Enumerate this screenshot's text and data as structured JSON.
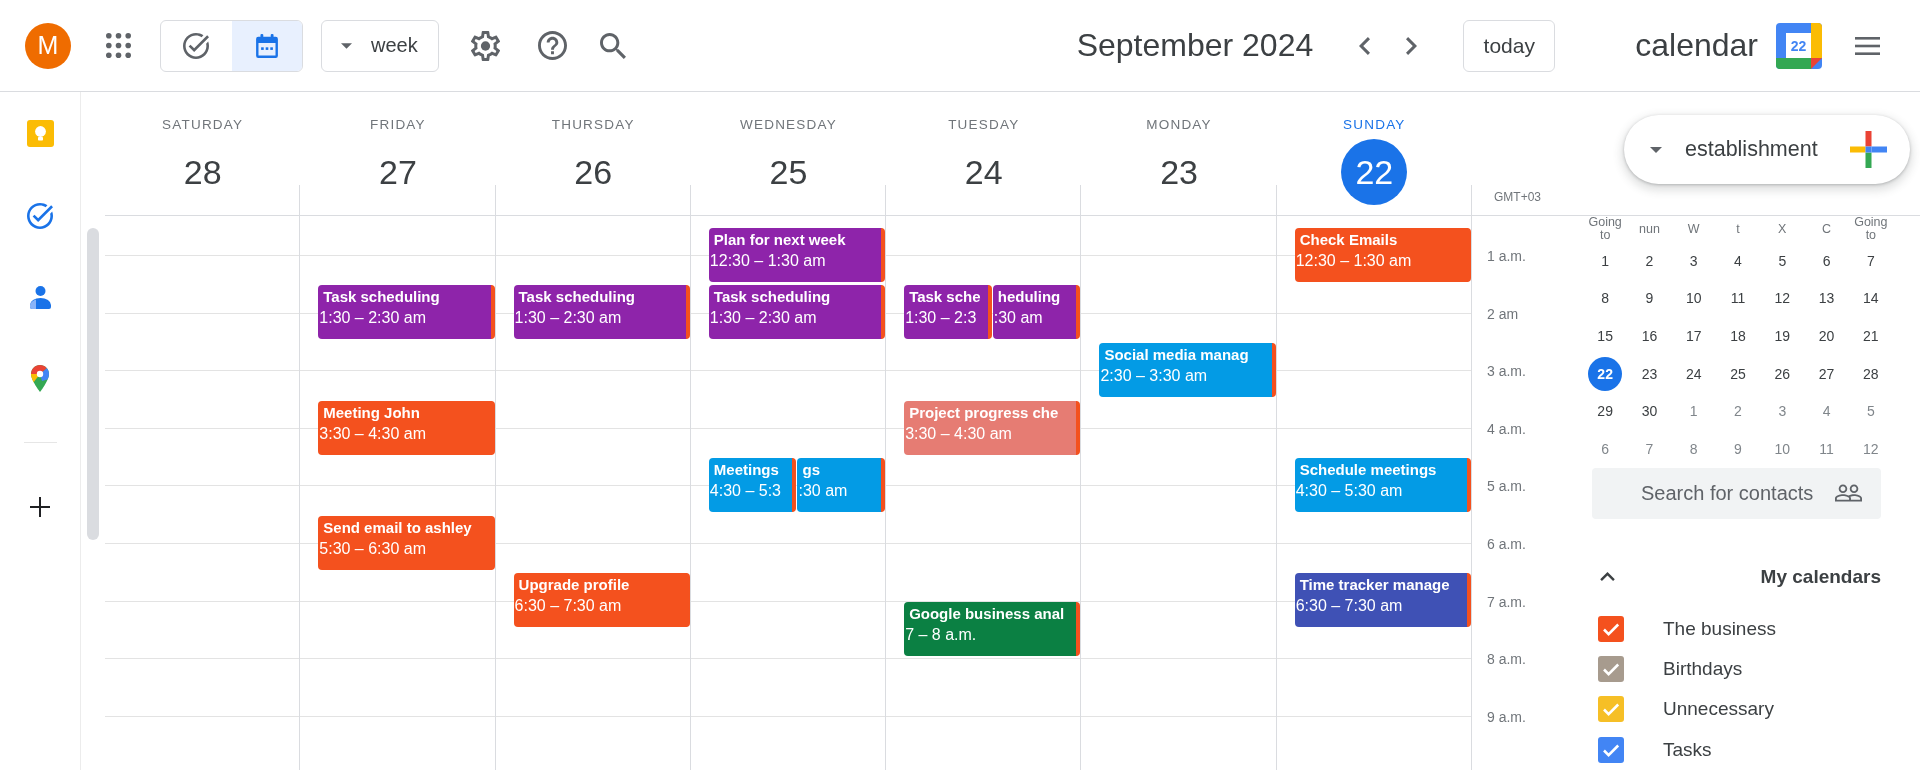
{
  "top_bar": {
    "avatar_initial": "M",
    "view_toggle": [
      {
        "kind": "tasks",
        "selected": false
      },
      {
        "kind": "calendar",
        "selected": true
      }
    ],
    "view_menu": "week",
    "month_title": "September 2024",
    "today_button": "today",
    "app_name": "calendar",
    "logo_text": "22"
  },
  "calendar": {
    "timezone": "GMT+03",
    "days": [
      {
        "name": "SATURDAY",
        "date": "28",
        "today": false
      },
      {
        "name": "FRIDAY",
        "date": "27",
        "today": false,
        "slots": [
          {
            "events": [
              {
                "title": "Task scheduling",
                "time": "1:30 – 2:30 am",
                "color": "#8e24aa"
              }
            ]
          },
          {
            "events": [
              {
                "title": "Meeting John",
                "time": "3:30 – 4:30 am",
                "color": "#f4511e"
              }
            ]
          },
          {
            "events": [
              {
                "title": "Send email to ashley",
                "time": "5:30 – 6:30 am",
                "color": "#f4511e"
              }
            ]
          }
        ]
      },
      {
        "name": "THURSDAY",
        "date": "26",
        "today": false,
        "slots": [
          {
            "events": [
              {
                "title": "Task scheduling",
                "time": "1:30 – 2:30 am",
                "color": "#8e24aa"
              }
            ]
          },
          {
            "events": [
              {
                "title": "Upgrade profile",
                "time": "6:30 – 7:30 am",
                "color": "#f4511e"
              }
            ]
          }
        ]
      },
      {
        "name": "WEDNESDAY",
        "date": "25",
        "today": false,
        "slots": [
          {
            "events": [
              {
                "title": "Plan for next week",
                "time": "12:30 – 1:30 am",
                "color": "#8e24aa"
              }
            ]
          },
          {
            "events": [
              {
                "title": "Task scheduling",
                "time": "1:30 – 2:30 am",
                "color": "#8e24aa"
              }
            ]
          },
          {
            "events": [
              {
                "title": "Meetings",
                "time": "4:30 – 5:3",
                "color": "#039be5"
              },
              {
                "title": "gs",
                "time": ":30 am",
                "color": "#039be5"
              }
            ]
          }
        ]
      },
      {
        "name": "TUESDAY",
        "date": "24",
        "today": false,
        "slots": [
          {
            "events": [
              {
                "title": "Task sche",
                "time": "1:30 – 2:3",
                "color": "#8e24aa"
              },
              {
                "title": "heduling",
                "time": ":30 am",
                "color": "#8e24aa"
              }
            ]
          },
          {
            "events": [
              {
                "title": "Project progress che",
                "time": "3:30 – 4:30 am",
                "color": "#e67c73"
              }
            ]
          },
          {
            "events": [
              {
                "title": "Google business anal",
                "time": "7 – 8 a.m.",
                "color": "#0b8043"
              }
            ]
          }
        ]
      },
      {
        "name": "MONDAY",
        "date": "23",
        "today": false,
        "slots": [
          {
            "events": [
              {
                "title": "Social media manag",
                "time": "2:30 – 3:30 am",
                "color": "#039be5"
              }
            ]
          }
        ]
      },
      {
        "name": "SUNDAY",
        "date": "22",
        "today": true,
        "slots": [
          {
            "events": [
              {
                "title": "Check Emails",
                "time": "12:30 – 1:30 am",
                "color": "#f4511e"
              }
            ]
          },
          {
            "events": [
              {
                "title": "Schedule meetings",
                "time": "4:30 – 5:30 am",
                "color": "#039be5"
              }
            ]
          },
          {
            "events": [
              {
                "title": "Time tracker manage",
                "time": "6:30 – 7:30 am",
                "color": "#3f51b5"
              }
            ]
          }
        ]
      }
    ],
    "hour_labels": [
      "1 a.m.",
      "2 am",
      "3 a.m.",
      "4 a.m.",
      "5 a.m.",
      "6 a.m.",
      "7 a.m.",
      "8 a.m.",
      "9 a.m."
    ]
  },
  "side_panel": {
    "create_button": "establishment",
    "mini_calendar": {
      "weekdays": [
        "Going to",
        "nun",
        "W",
        "t",
        "X",
        "C",
        "Going to"
      ],
      "weeks": [
        [
          {
            "day": "1",
            "selected": false,
            "other_month": false
          },
          {
            "day": "2",
            "selected": false,
            "other_month": false
          },
          {
            "day": "3",
            "selected": false,
            "other_month": false
          },
          {
            "day": "4",
            "selected": false,
            "other_month": false
          },
          {
            "day": "5",
            "selected": false,
            "other_month": false
          },
          {
            "day": "6",
            "selected": false,
            "other_month": false
          },
          {
            "day": "7",
            "selected": false,
            "other_month": false
          }
        ],
        [
          {
            "day": "8",
            "selected": false,
            "other_month": false
          },
          {
            "day": "9",
            "selected": false,
            "other_month": false
          },
          {
            "day": "10",
            "selected": false,
            "other_month": false
          },
          {
            "day": "11",
            "selected": false,
            "other_month": false
          },
          {
            "day": "12",
            "selected": false,
            "other_month": false
          },
          {
            "day": "13",
            "selected": false,
            "other_month": false
          },
          {
            "day": "14",
            "selected": false,
            "other_month": false
          }
        ],
        [
          {
            "day": "15",
            "selected": false,
            "other_month": false
          },
          {
            "day": "16",
            "selected": false,
            "other_month": false
          },
          {
            "day": "17",
            "selected": false,
            "other_month": false
          },
          {
            "day": "18",
            "selected": false,
            "other_month": false
          },
          {
            "day": "19",
            "selected": false,
            "other_month": false
          },
          {
            "day": "20",
            "selected": false,
            "other_month": false
          },
          {
            "day": "21",
            "selected": false,
            "other_month": false
          }
        ],
        [
          {
            "day": "22",
            "selected": true,
            "other_month": false
          },
          {
            "day": "23",
            "selected": false,
            "other_month": false
          },
          {
            "day": "24",
            "selected": false,
            "other_month": false
          },
          {
            "day": "25",
            "selected": false,
            "other_month": false
          },
          {
            "day": "26",
            "selected": false,
            "other_month": false
          },
          {
            "day": "27",
            "selected": false,
            "other_month": false
          },
          {
            "day": "28",
            "selected": false,
            "other_month": false
          }
        ],
        [
          {
            "day": "29",
            "selected": false,
            "other_month": false
          },
          {
            "day": "30",
            "selected": false,
            "other_month": false
          },
          {
            "day": "1",
            "selected": false,
            "other_month": true
          },
          {
            "day": "2",
            "selected": false,
            "other_month": true
          },
          {
            "day": "3",
            "selected": false,
            "other_month": true
          },
          {
            "day": "4",
            "selected": false,
            "other_month": true
          },
          {
            "day": "5",
            "selected": false,
            "other_month": true
          }
        ],
        [
          {
            "day": "6",
            "selected": false,
            "other_month": true
          },
          {
            "day": "7",
            "selected": false,
            "other_month": true
          },
          {
            "day": "8",
            "selected": false,
            "other_month": true
          },
          {
            "day": "9",
            "selected": false,
            "other_month": true
          },
          {
            "day": "10",
            "selected": false,
            "other_month": true
          },
          {
            "day": "11",
            "selected": false,
            "other_month": true
          },
          {
            "day": "12",
            "selected": false,
            "other_month": true
          }
        ]
      ]
    },
    "contact_search": {
      "placeholder": "Search for contacts"
    },
    "my_calendars": {
      "title": "My calendars",
      "expanded": true,
      "items": [
        {
          "label": "The business",
          "checked": true,
          "color": "#f4511e"
        },
        {
          "label": "Birthdays",
          "checked": true,
          "color": "#a79b8e"
        },
        {
          "label": "Unnecessary",
          "checked": true,
          "color": "#f6bf26"
        },
        {
          "label": "Tasks",
          "checked": true,
          "color": "#4285f4"
        }
      ]
    }
  }
}
